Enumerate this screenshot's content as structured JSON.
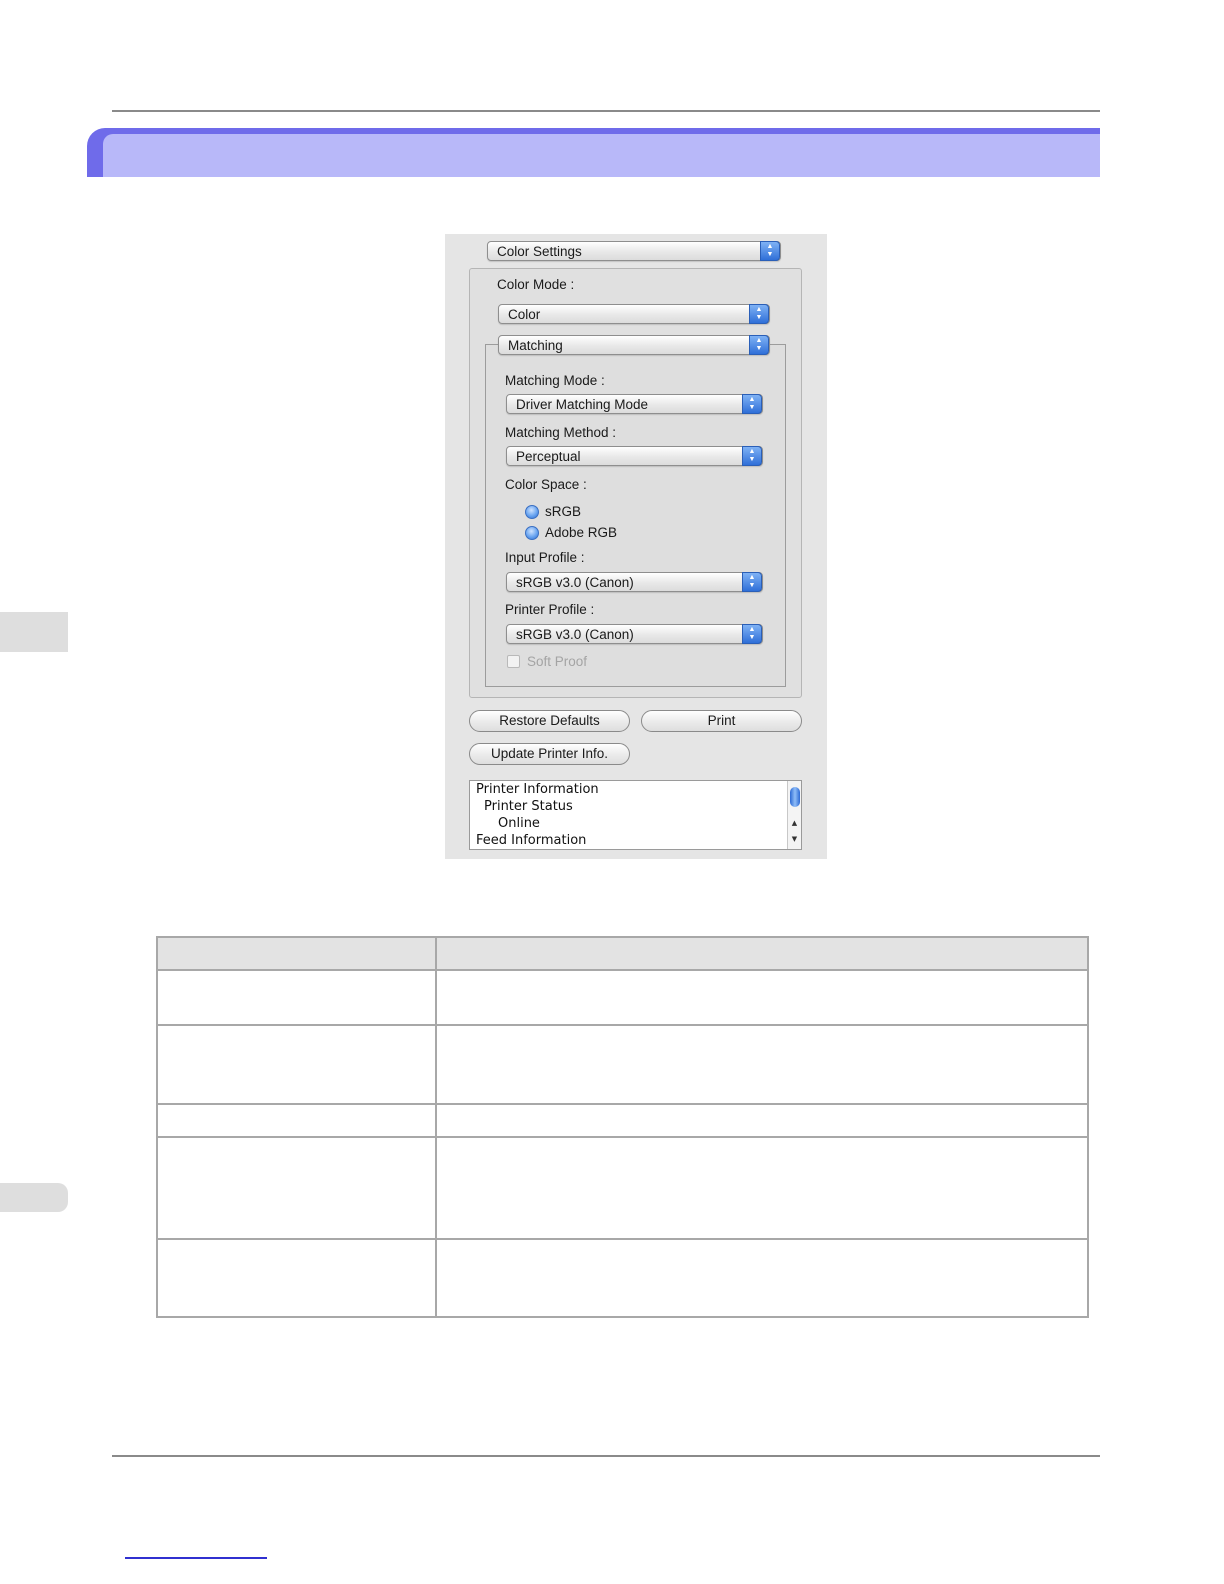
{
  "dialog": {
    "top_popup": "Color Settings",
    "color_mode_label": "Color Mode :",
    "color_mode_value": "Color",
    "matching_popup": "Matching",
    "matching_mode_label": "Matching Mode :",
    "matching_mode_value": "Driver Matching Mode",
    "matching_method_label": "Matching Method :",
    "matching_method_value": "Perceptual",
    "color_space_label": "Color Space :",
    "color_space_options": [
      "sRGB",
      "Adobe RGB"
    ],
    "input_profile_label": "Input Profile :",
    "input_profile_value": "sRGB v3.0 (Canon)",
    "printer_profile_label": "Printer Profile :",
    "printer_profile_value": "sRGB v3.0 (Canon)",
    "soft_proof_label": "Soft Proof",
    "buttons": {
      "restore_defaults": "Restore Defaults",
      "print": "Print",
      "update_printer_info": "Update Printer Info."
    },
    "info_lines": [
      "Printer Information",
      "Printer Status",
      "Online",
      "Feed Information"
    ]
  },
  "colors": {
    "title_bar_accent": "#6f6bea",
    "title_bar_fill": "#b8b8f9",
    "side_tab": "#dedede",
    "footer_link": "#3030d0"
  },
  "table": {
    "rows": 5,
    "columns": 2
  }
}
